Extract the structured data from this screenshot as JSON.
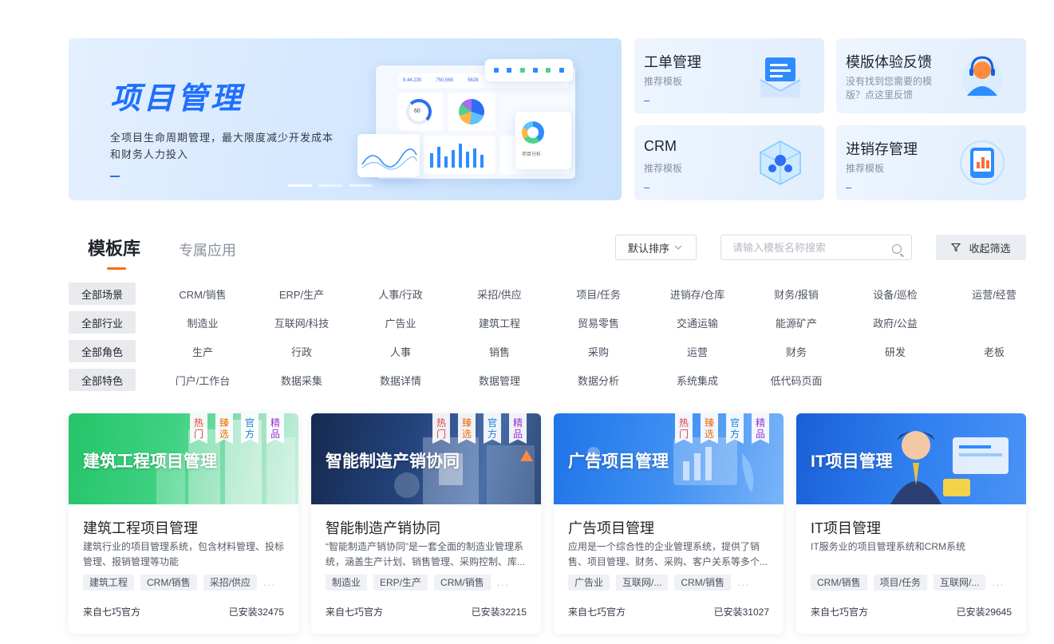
{
  "hero": {
    "title": "项目管理",
    "description": "全项目生命周期管理，最大限度减少开发成本和财务人力投入",
    "mock_stats": [
      "9,44,230",
      "750,560",
      "5628"
    ],
    "mock_gauge": "60",
    "mock_caption": "项目分析"
  },
  "tiles": [
    {
      "title": "工单管理",
      "subtitle": "推荐模板",
      "icon": "ticket-icon"
    },
    {
      "title": "模版体验反馈",
      "subtitle": "没有找到您需要的模版？点这里反馈",
      "icon": "support-agent-icon"
    },
    {
      "title": "CRM",
      "subtitle": "推荐模板",
      "icon": "crm-cube-icon"
    },
    {
      "title": "进销存管理",
      "subtitle": "推荐模板",
      "icon": "inventory-chart-icon"
    }
  ],
  "tabs": [
    {
      "label": "模板库",
      "active": true
    },
    {
      "label": "专属应用",
      "active": false
    }
  ],
  "toolbar": {
    "sort_label": "默认排序",
    "search_placeholder": "请输入模板名称搜索",
    "filter_label": "收起筛选"
  },
  "filters": [
    {
      "head": "全部场景",
      "items": [
        "CRM/销售",
        "ERP/生产",
        "人事/行政",
        "采招/供应",
        "项目/任务",
        "进销存/仓库",
        "财务/报销",
        "设备/巡检",
        "运营/经营"
      ]
    },
    {
      "head": "全部行业",
      "items": [
        "制造业",
        "互联网/科技",
        "广告业",
        "建筑工程",
        "贸易零售",
        "交通运输",
        "能源矿产",
        "政府/公益"
      ]
    },
    {
      "head": "全部角色",
      "items": [
        "生产",
        "行政",
        "人事",
        "销售",
        "采购",
        "运营",
        "财务",
        "研发",
        "老板"
      ]
    },
    {
      "head": "全部特色",
      "items": [
        "门户/工作台",
        "数据采集",
        "数据详情",
        "数据管理",
        "数据分析",
        "系统集成",
        "低代码页面"
      ]
    }
  ],
  "ribbon_labels": [
    "热门",
    "臻选",
    "官方",
    "精品"
  ],
  "colors": {
    "accent": "#2d6ef5",
    "tab_underline": "#ff6a00",
    "hot": "#e83a3a",
    "select": "#f06a00",
    "official": "#1a7fd8",
    "premium": "#9a2ed8"
  },
  "cards": [
    {
      "banner_title": "建筑工程项目管理",
      "title": "建筑工程项目管理",
      "description": "建筑行业的项目管理系统，包含材料管理、投标管理、报销管理等功能",
      "tags": [
        "建筑工程",
        "CRM/销售",
        "采招/供应"
      ],
      "more": "...",
      "from": "来自七巧官方",
      "installs": "已安装32475",
      "ribbons": true
    },
    {
      "banner_title": "智能制造产销协同",
      "title": "智能制造产销协同",
      "description": "“智能制造产销协同”是一套全面的制造业管理系统，涵盖生产计划、销售管理、采购控制、库...",
      "tags": [
        "制造业",
        "ERP/生产",
        "CRM/销售"
      ],
      "more": "...",
      "from": "来自七巧官方",
      "installs": "已安装32215",
      "ribbons": true
    },
    {
      "banner_title": "广告项目管理",
      "title": "广告项目管理",
      "description": "应用是一个综合性的企业管理系统，提供了销售、项目管理、财务、采购、客户关系等多个...",
      "tags": [
        "广告业",
        "互联网/...",
        "CRM/销售"
      ],
      "more": "...",
      "from": "来自七巧官方",
      "installs": "已安装31027",
      "ribbons": true
    },
    {
      "banner_title": "IT项目管理",
      "title": "IT项目管理",
      "description": "IT服务业的项目管理系统和CRM系统",
      "tags": [
        "CRM/销售",
        "项目/任务",
        "互联网/..."
      ],
      "more": "...",
      "from": "来自七巧官方",
      "installs": "已安装29645",
      "ribbons": false
    }
  ]
}
